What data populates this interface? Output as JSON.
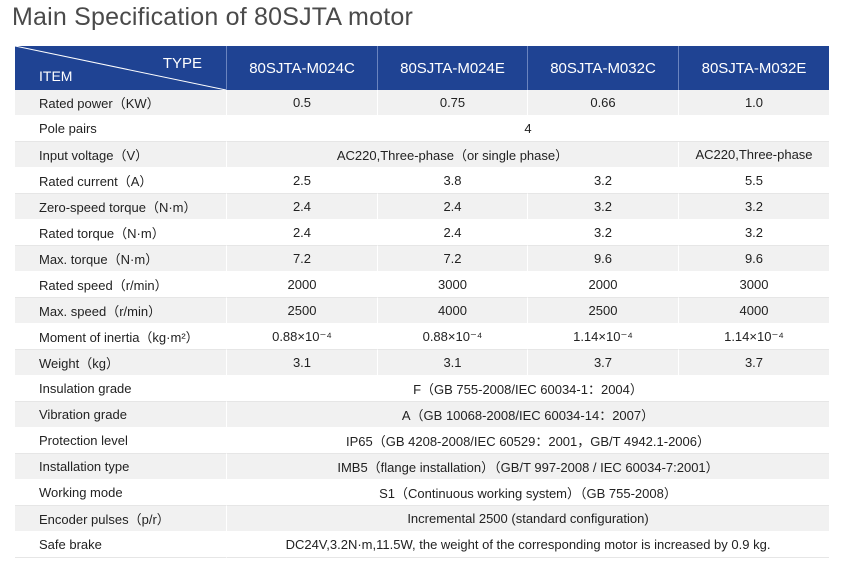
{
  "title": "Main Specification of 80SJTA motor",
  "header": {
    "type_label": "TYPE",
    "item_label": "ITEM",
    "models": [
      "80SJTA-M024C",
      "80SJTA-M024E",
      "80SJTA-M032C",
      "80SJTA-M032E"
    ]
  },
  "rows": {
    "rated_power": {
      "label": "Rated power（KW）",
      "values": [
        "0.5",
        "0.75",
        "0.66",
        "1.0"
      ]
    },
    "pole_pairs": {
      "label": "Pole pairs",
      "value": "4"
    },
    "input_voltage": {
      "label": "Input voltage（V）",
      "value_abc": "AC220,Three-phase（or single phase）",
      "value_d": "AC220,Three-phase"
    },
    "rated_current": {
      "label": "Rated current（A）",
      "values": [
        "2.5",
        "3.8",
        "3.2",
        "5.5"
      ]
    },
    "zero_speed_torque": {
      "label": "Zero-speed torque（N·m）",
      "values": [
        "2.4",
        "2.4",
        "3.2",
        "3.2"
      ]
    },
    "rated_torque": {
      "label": "Rated torque（N·m）",
      "values": [
        "2.4",
        "2.4",
        "3.2",
        "3.2"
      ]
    },
    "max_torque": {
      "label": "Max. torque（N·m）",
      "values": [
        "7.2",
        "7.2",
        "9.6",
        "9.6"
      ]
    },
    "rated_speed": {
      "label": "Rated speed（r/min）",
      "values": [
        "2000",
        "3000",
        "2000",
        "3000"
      ]
    },
    "max_speed": {
      "label": "Max. speed（r/min）",
      "values": [
        "2500",
        "4000",
        "2500",
        "4000"
      ]
    },
    "moment_of_inertia": {
      "label": "Moment of inertia（kg·m²）",
      "values": [
        "0.88×10⁻⁴",
        "0.88×10⁻⁴",
        "1.14×10⁻⁴",
        "1.14×10⁻⁴"
      ]
    },
    "weight": {
      "label": "Weight（kg）",
      "values": [
        "3.1",
        "3.1",
        "3.7",
        "3.7"
      ]
    },
    "insulation_grade": {
      "label": "Insulation grade",
      "value": "F（GB 755-2008/IEC 60034-1：2004）"
    },
    "vibration_grade": {
      "label": "Vibration grade",
      "value": "A（GB 10068-2008/IEC 60034-14：2007）"
    },
    "protection_level": {
      "label": "Protection level",
      "value": "IP65（GB 4208-2008/IEC 60529：2001，GB/T 4942.1-2006）"
    },
    "installation_type": {
      "label": "Installation type",
      "value": "IMB5（flange installation）（GB/T 997-2008 / IEC 60034-7:2001）"
    },
    "working_mode": {
      "label": "Working mode",
      "value": "S1（Continuous working system）（GB 755-2008）"
    },
    "encoder_pulses": {
      "label": "Encoder pulses（p/r）",
      "value": "Incremental 2500 (standard configuration)"
    },
    "safe_brake": {
      "label": "Safe brake",
      "value": "DC24V,3.2N·m,11.5W, the weight of the corresponding motor is increased by 0.9 kg."
    }
  }
}
